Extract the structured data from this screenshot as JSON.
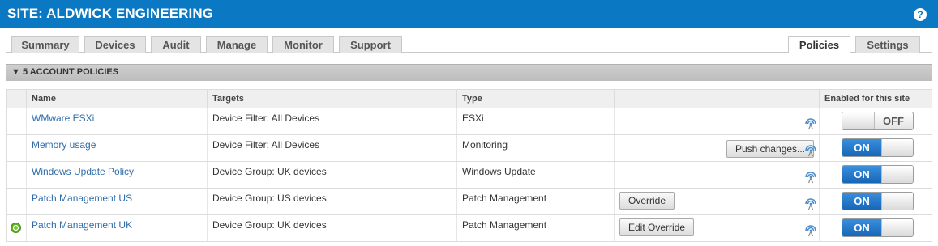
{
  "header": {
    "title": "SITE: ALDWICK ENGINEERING",
    "help_label": "?"
  },
  "tabs_left": [
    "Summary",
    "Devices",
    "Audit",
    "Manage",
    "Monitor",
    "Support"
  ],
  "tabs_right": [
    "Policies",
    "Settings"
  ],
  "active_tab": "Policies",
  "section": {
    "label": "▼ 5 ACCOUNT POLICIES"
  },
  "columns": {
    "name": "Name",
    "targets": "Targets",
    "type": "Type",
    "enabled": "Enabled for this site"
  },
  "toggle": {
    "on": "ON",
    "off": "OFF"
  },
  "rows": [
    {
      "name": "WMware ESXi",
      "targets": "Device Filter: All Devices",
      "type": "ESXi",
      "action": "",
      "push": "",
      "enabled": false,
      "status": false
    },
    {
      "name": "Memory usage",
      "targets": "Device Filter: All Devices",
      "type": "Monitoring",
      "action": "",
      "push": "Push changes...",
      "enabled": true,
      "status": false
    },
    {
      "name": "Windows Update Policy",
      "targets": "Device Group: UK devices",
      "type": "Windows Update",
      "action": "",
      "push": "",
      "enabled": true,
      "status": false
    },
    {
      "name": "Patch Management US",
      "targets": "Device Group: US devices",
      "type": "Patch Management",
      "action": "Override",
      "push": "",
      "enabled": true,
      "status": false
    },
    {
      "name": "Patch Management UK",
      "targets": "Device Group: UK devices",
      "type": "Patch Management",
      "action": "Edit Override",
      "push": "",
      "enabled": true,
      "status": true
    }
  ]
}
